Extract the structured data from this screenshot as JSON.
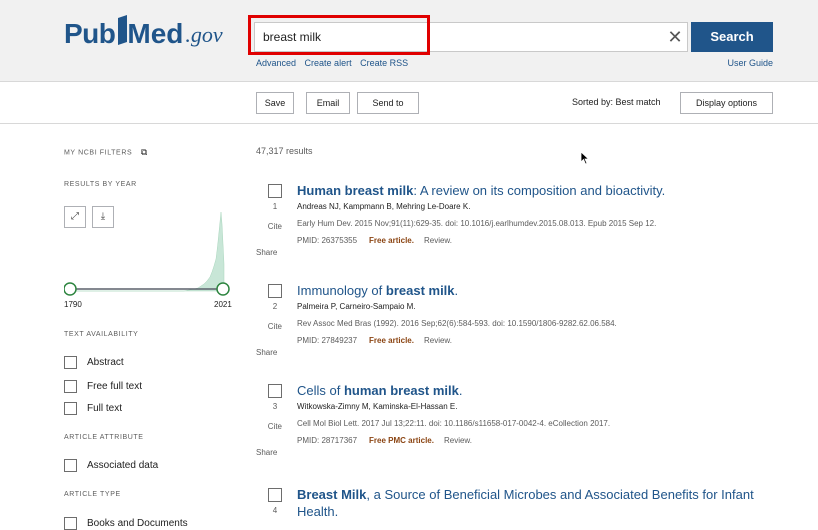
{
  "header": {
    "logo_pub": "Pub",
    "logo_med": "Med",
    "logo_gov": ".gov",
    "search_value": "breast milk",
    "search_button": "Search",
    "links": [
      "Advanced",
      "Create alert",
      "Create RSS"
    ],
    "user_guide": "User Guide"
  },
  "toolbar": {
    "save": "Save",
    "email": "Email",
    "send_to": "Send to",
    "sorted_by": "Sorted by: Best match",
    "display_options": "Display options"
  },
  "sidebar": {
    "my_filters": "MY NCBI FILTERS",
    "results_by_year": "RESULTS BY YEAR",
    "year_start": "1790",
    "year_end": "2021",
    "text_availability": "TEXT AVAILABILITY",
    "text_filters": [
      "Abstract",
      "Free full text",
      "Full text"
    ],
    "article_attribute": "ARTICLE ATTRIBUTE",
    "attribute_filters": [
      "Associated data"
    ],
    "article_type": "ARTICLE TYPE",
    "type_filters": [
      "Books and Documents"
    ]
  },
  "results": {
    "count": "47,317 results",
    "cite_label": "Cite",
    "share_label": "Share",
    "articles": [
      {
        "num": "1",
        "title_bold": "Human breast milk",
        "title_rest": ": A review on its composition and bioactivity.",
        "authors": "Andreas NJ, Kampmann B, Mehring Le-Doare K.",
        "journal": "Early Hum Dev. 2015 Nov;91(11):629-35. doi: 10.1016/j.earlhumdev.2015.08.013. Epub 2015 Sep 12.",
        "pmid": "PMID: 26375355",
        "free": "Free article.",
        "review": "Review."
      },
      {
        "num": "2",
        "title_pre": "Immunology of ",
        "title_bold": "breast milk",
        "title_rest": ".",
        "authors": "Palmeira P, Carneiro-Sampaio M.",
        "journal": "Rev Assoc Med Bras (1992). 2016 Sep;62(6):584-593. doi: 10.1590/1806-9282.62.06.584.",
        "pmid": "PMID: 27849237",
        "free": "Free article.",
        "review": "Review."
      },
      {
        "num": "3",
        "title_pre": "Cells of ",
        "title_bold": "human breast milk",
        "title_rest": ".",
        "authors": "Witkowska-Zimny M, Kaminska-El-Hassan E.",
        "journal": "Cell Mol Biol Lett. 2017 Jul 13;22:11. doi: 10.1186/s11658-017-0042-4. eCollection 2017.",
        "pmid": "PMID: 28717367",
        "free": "Free PMC article.",
        "review": "Review."
      },
      {
        "num": "4",
        "title_bold": "Breast Milk",
        "title_rest": ", a Source of Beneficial Microbes and Associated Benefits for Infant Health."
      }
    ]
  },
  "colors": {
    "brand": "#20558a",
    "highlight": "#e00000",
    "free_article": "#8b4513"
  }
}
